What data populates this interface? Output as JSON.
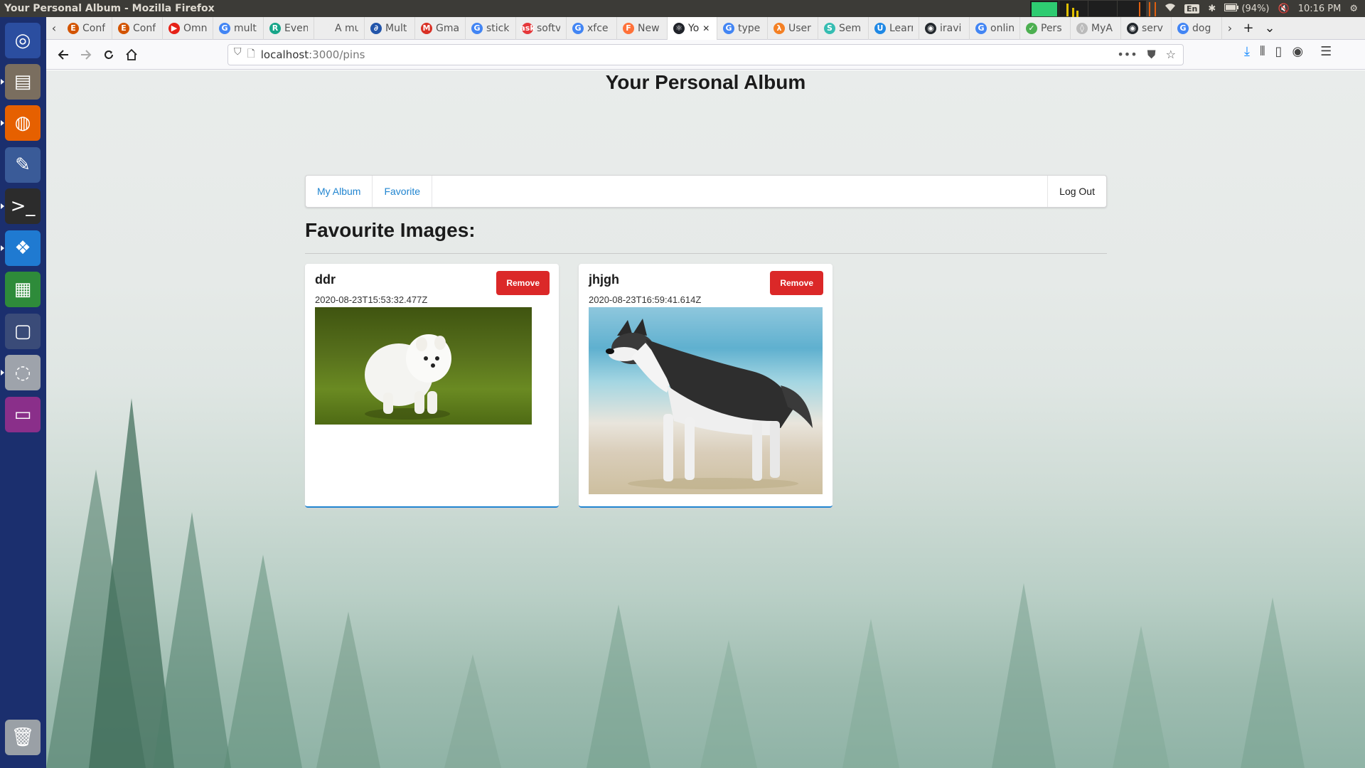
{
  "os": {
    "window_title": "Your Personal Album - Mozilla Firefox",
    "keyboard_layout": "En",
    "battery": "(94%)",
    "clock": "10:16 PM"
  },
  "launcher": [
    {
      "name": "ubuntu-dash-icon",
      "color": "#2b4ea0"
    },
    {
      "name": "files-icon",
      "color": "#7a6e5f"
    },
    {
      "name": "firefox-icon",
      "color": "#e66000"
    },
    {
      "name": "settings-icon",
      "color": "#3a5b98"
    },
    {
      "name": "terminal-icon",
      "color": "#2c2c2c"
    },
    {
      "name": "vscode-icon",
      "color": "#1f7ad1"
    },
    {
      "name": "spreadsheet-icon",
      "color": "#2e8b3a"
    },
    {
      "name": "workspace-switcher-icon",
      "color": "#3a4b78"
    },
    {
      "name": "disk-icon",
      "color": "#9ea3ab"
    },
    {
      "name": "app-window-icon",
      "color": "#8a2f8a"
    },
    {
      "name": "trash-icon",
      "color": "#9aa0a6"
    }
  ],
  "tabs": [
    {
      "label": "Conf",
      "icon": "E",
      "color": "#d35400"
    },
    {
      "label": "Conf",
      "icon": "E",
      "color": "#d35400"
    },
    {
      "label": "Omn",
      "icon": "▶",
      "color": "#e62117"
    },
    {
      "label": "mult",
      "icon": "G",
      "color": "#4285f4"
    },
    {
      "label": "Even",
      "icon": "R",
      "color": "#17a589"
    },
    {
      "label": "A multi-",
      "icon": "",
      "color": "#ededed"
    },
    {
      "label": "Mult",
      "icon": "∂",
      "color": "#2255aa"
    },
    {
      "label": "Gma",
      "icon": "M",
      "color": "#d93025"
    },
    {
      "label": "stick",
      "icon": "G",
      "color": "#4285f4"
    },
    {
      "label": "softv",
      "icon": "ask",
      "color": "#e5383b"
    },
    {
      "label": "xfce",
      "icon": "G",
      "color": "#4285f4"
    },
    {
      "label": "New",
      "icon": "F",
      "color": "#ff7139"
    },
    {
      "label": "Yo",
      "icon": "⚛",
      "color": "#20232a",
      "active": true
    },
    {
      "label": "type",
      "icon": "G",
      "color": "#4285f4"
    },
    {
      "label": "User",
      "icon": "λ",
      "color": "#f48024"
    },
    {
      "label": "Sem",
      "icon": "S",
      "color": "#35bdb2"
    },
    {
      "label": "Learn",
      "icon": "U",
      "color": "#1e88e5"
    },
    {
      "label": "iravi",
      "icon": "◉",
      "color": "#24292e"
    },
    {
      "label": "onlin",
      "icon": "G",
      "color": "#4285f4"
    },
    {
      "label": "Pers",
      "icon": "✓",
      "color": "#4caf50"
    },
    {
      "label": "MyA",
      "icon": "◊",
      "color": "#bbbbbb"
    },
    {
      "label": "serv",
      "icon": "◉",
      "color": "#24292e"
    },
    {
      "label": "dog",
      "icon": "G",
      "color": "#4285f4"
    }
  ],
  "browser": {
    "url_host": "localhost",
    "url_path": ":3000/pins"
  },
  "page": {
    "title": "Your Personal Album",
    "menu": {
      "my_album": "My Album",
      "favorite": "Favorite",
      "logout": "Log Out"
    },
    "section_title": "Favourite Images:",
    "cards": [
      {
        "name": "ddr",
        "date": "2020-08-23T15:53:32.477Z",
        "remove_label": "Remove",
        "image": "white-pomeranian-puppy-on-grass"
      },
      {
        "name": "jhjgh",
        "date": "2020-08-23T16:59:41.614Z",
        "remove_label": "Remove",
        "image": "siberian-husky-on-beach"
      }
    ]
  },
  "colors": {
    "accent": "#2185d0",
    "danger": "#db2828"
  }
}
